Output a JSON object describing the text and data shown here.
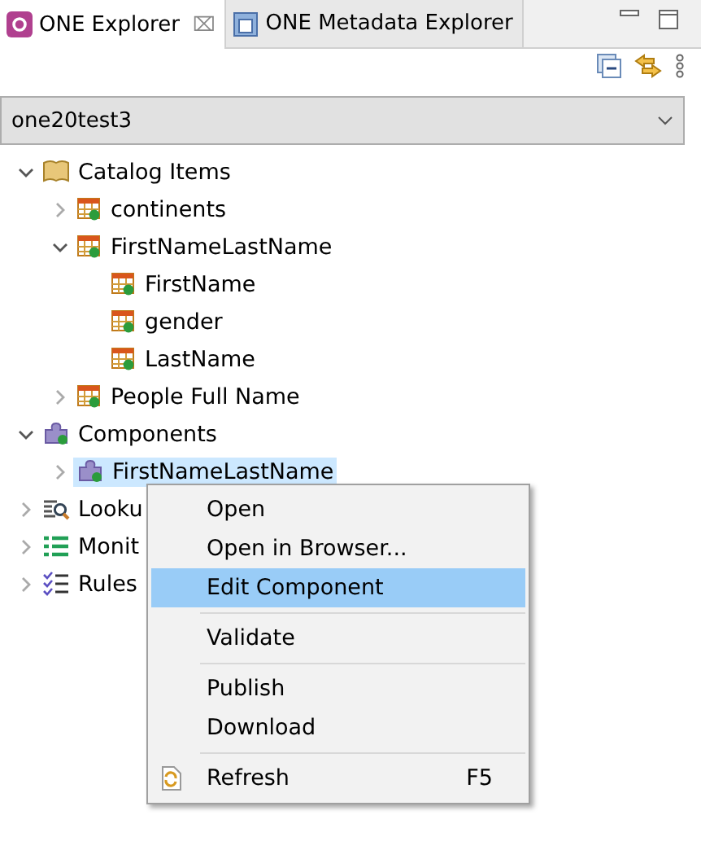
{
  "tabs": [
    {
      "label": "ONE Explorer",
      "selected": true,
      "close": "⌧"
    },
    {
      "label": "ONE Metadata Explorer",
      "selected": false
    }
  ],
  "combo": {
    "value": "one20test3"
  },
  "tree": [
    {
      "label": "Catalog Items",
      "kind": "catalog",
      "expanded": true,
      "children": [
        {
          "label": "continents",
          "kind": "table",
          "expanded": false
        },
        {
          "label": "FirstNameLastName",
          "kind": "table",
          "expanded": true,
          "children": [
            {
              "label": "FirstName",
              "kind": "table"
            },
            {
              "label": "gender",
              "kind": "table"
            },
            {
              "label": "LastName",
              "kind": "table"
            }
          ]
        },
        {
          "label": "People Full Name",
          "kind": "table",
          "expanded": false
        }
      ]
    },
    {
      "label": "Components",
      "kind": "component",
      "expanded": true,
      "children": [
        {
          "label": "FirstNameLastName",
          "kind": "component",
          "expanded": false,
          "selected": true
        }
      ]
    },
    {
      "label": "Looku",
      "kind": "lookup",
      "expanded": false
    },
    {
      "label": "Monit",
      "kind": "monitor",
      "expanded": false
    },
    {
      "label": "Rules",
      "kind": "rules",
      "expanded": false
    }
  ],
  "context_menu": [
    {
      "kind": "item",
      "label": "Open",
      "selected": false
    },
    {
      "kind": "item",
      "label": "Open in Browser...",
      "selected": false
    },
    {
      "kind": "item",
      "label": "Edit Component",
      "selected": true
    },
    {
      "kind": "separator"
    },
    {
      "kind": "item",
      "label": "Validate",
      "selected": false
    },
    {
      "kind": "separator"
    },
    {
      "kind": "item",
      "label": "Publish",
      "selected": false
    },
    {
      "kind": "item",
      "label": "Download",
      "selected": false
    },
    {
      "kind": "separator"
    },
    {
      "kind": "icon_item",
      "label": "Refresh",
      "selected": false,
      "shortcut": "F5"
    }
  ]
}
